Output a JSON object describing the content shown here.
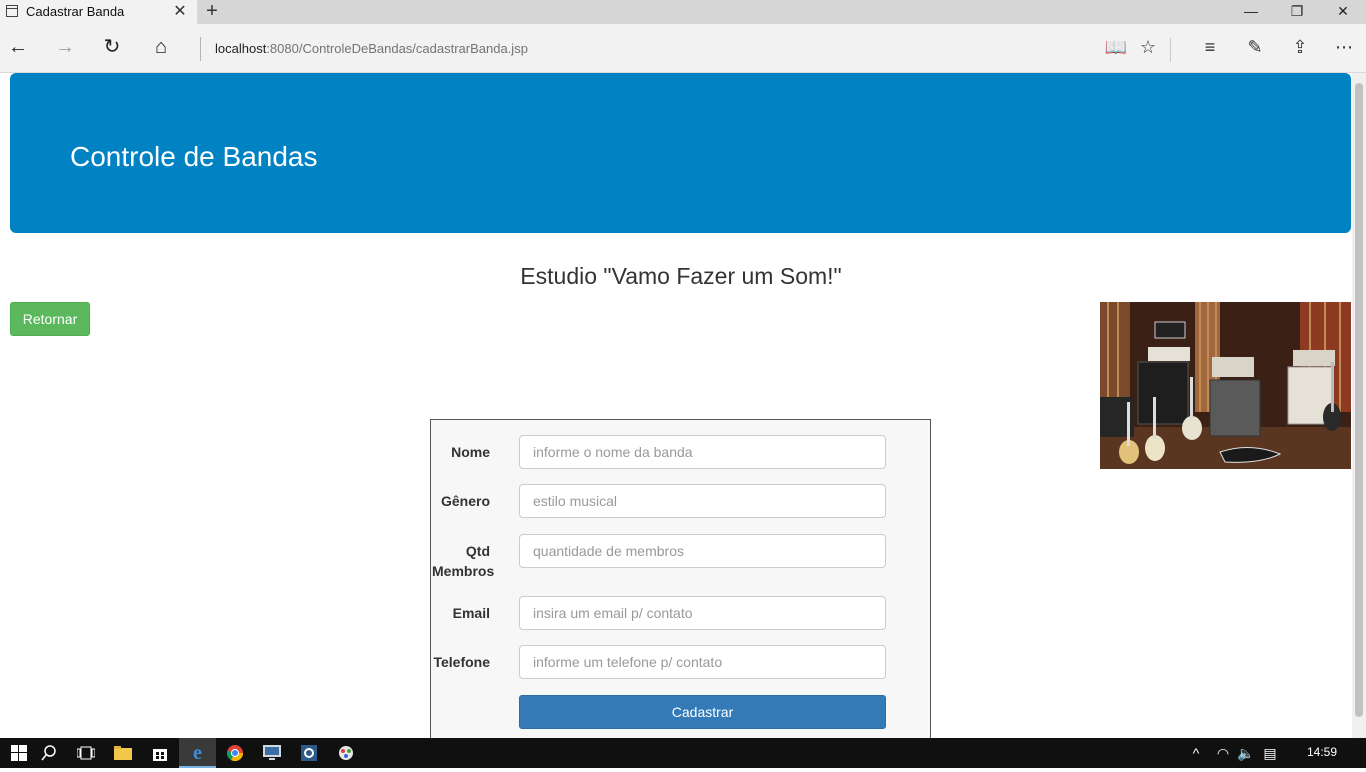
{
  "browser": {
    "tab_title": "Cadastrar Banda",
    "tab_close": "✕",
    "new_tab": "+",
    "window_controls": {
      "minimize": "—",
      "restore": "❐",
      "close": "✕"
    },
    "address": {
      "host": "localhost",
      "rest": ":8080/ControleDeBandas/cadastrarBanda.jsp"
    },
    "nav_icons": {
      "back": "←",
      "forward": "→",
      "refresh": "↻",
      "home": "⌂"
    },
    "right_icons": {
      "reading_view": "📖",
      "favorites": "☆",
      "hub": "≡",
      "notes": "✎",
      "share": "⇪",
      "more": "⋯"
    }
  },
  "page": {
    "header_title": "Controle de Bandas",
    "studio_title": "Estudio \"Vamo Fazer um Som!\"",
    "return_button": "Retornar",
    "form": {
      "nome": {
        "label": "Nome",
        "placeholder": "informe o nome da banda"
      },
      "genero": {
        "label": "Gênero",
        "placeholder": "estilo musical"
      },
      "qtd": {
        "label_line1": "Qtd",
        "label_line2": "Membros",
        "placeholder": "quantidade de membros"
      },
      "email": {
        "label": "Email",
        "placeholder": "insira um email p/ contato"
      },
      "telefone": {
        "label": "Telefone",
        "placeholder": "informe um telefone p/ contato"
      },
      "submit": "Cadastrar"
    }
  },
  "taskbar": {
    "icons": [
      "windows-start-icon",
      "search-icon",
      "task-view-icon",
      "file-explorer-icon",
      "store-icon",
      "edge-icon",
      "chrome-icon",
      "app-icon-1",
      "app-icon-2",
      "app-icon-3"
    ],
    "tray": {
      "chevron": "^",
      "network": "◠",
      "volume": "🔈",
      "notifications": "▤"
    },
    "clock": "14:59"
  },
  "colors": {
    "jumbotron": "#0082c3",
    "success": "#5cb85c",
    "primary": "#337ab7"
  }
}
